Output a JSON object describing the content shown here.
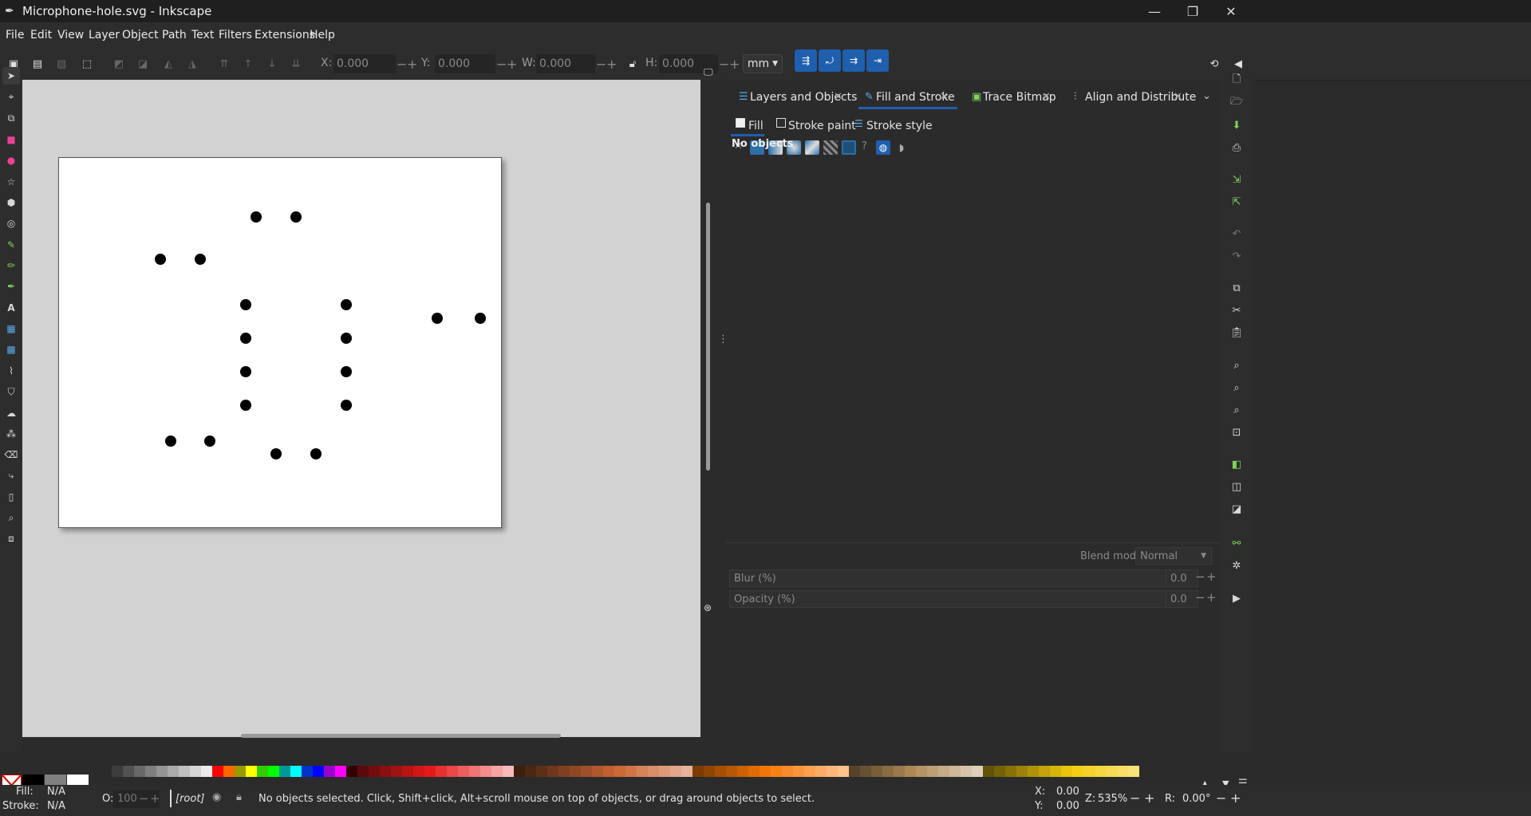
{
  "window": {
    "title": "Microphone-hole.svg - Inkscape"
  },
  "menu": [
    "File",
    "Edit",
    "View",
    "Layer",
    "Object",
    "Path",
    "Text",
    "Filters",
    "Extensions",
    "Help"
  ],
  "toolbar": {
    "x_label": "X:",
    "x_value": "0.000",
    "y_label": "Y:",
    "y_value": "0.000",
    "w_label": "W:",
    "w_value": "0.000",
    "h_label": "H:",
    "h_value": "0.000",
    "unit": "mm"
  },
  "dock": {
    "tabs": [
      "Layers and Objects",
      "Fill and Stroke",
      "Trace Bitmap",
      "Align and Distribute"
    ],
    "active_tab": "Fill and Stroke",
    "subtabs": [
      "Fill",
      "Stroke paint",
      "Stroke style"
    ],
    "message": "No objects",
    "blend_label": "Blend mode:",
    "blend_value": "Normal",
    "blur_label": "Blur (%)",
    "blur_value": "0.0",
    "opacity_label": "Opacity (%)",
    "opacity_value": "0.0"
  },
  "status": {
    "fill_label": "Fill:",
    "fill_value": "N/A",
    "stroke_label": "Stroke:",
    "stroke_value": "N/A",
    "opacity_label": "O:",
    "opacity_value": "100",
    "layer": "[root]",
    "message": "No objects selected. Click, Shift+click, Alt+scroll mouse on top of objects, or drag around objects to select.",
    "x_label": "X:",
    "x_value": "0.00",
    "y_label": "Y:",
    "y_value": "0.00",
    "zoom_label": "Z:",
    "zoom_value": "535%",
    "rotate_label": "R:",
    "rotate_value": "0.00°"
  },
  "colors": {
    "accent": "#1f5fad",
    "canvas": "#d2d2d2",
    "page": "#ffffff"
  }
}
